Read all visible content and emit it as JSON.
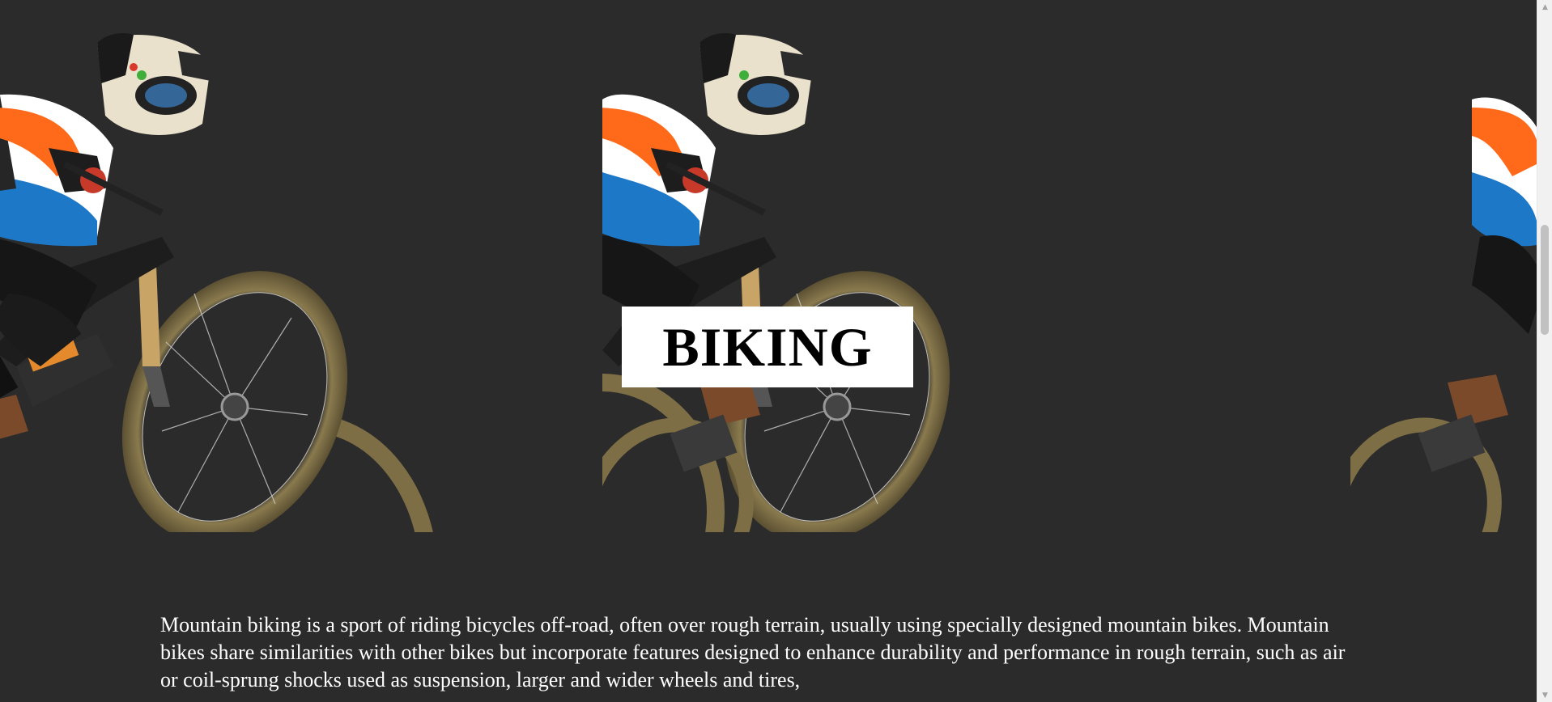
{
  "hero": {
    "title": "BIKING",
    "image_alt": "mountain biker jumping"
  },
  "content": {
    "paragraph": "Mountain biking is a sport of riding bicycles off-road, often over rough terrain, usually using specially designed mountain bikes. Mountain bikes share similarities with other bikes but incorporate features designed to enhance durability and performance in rough terrain, such as air or coil-sprung shocks used as suspension, larger and wider wheels and tires,"
  },
  "scrollbar": {
    "up_icon": "triangle-up",
    "down_icon": "triangle-down",
    "position": 0.38
  },
  "colors": {
    "background": "#2b2b2b",
    "title_box": "#ffffff",
    "title_text": "#000000",
    "body_text": "#ffffff"
  }
}
